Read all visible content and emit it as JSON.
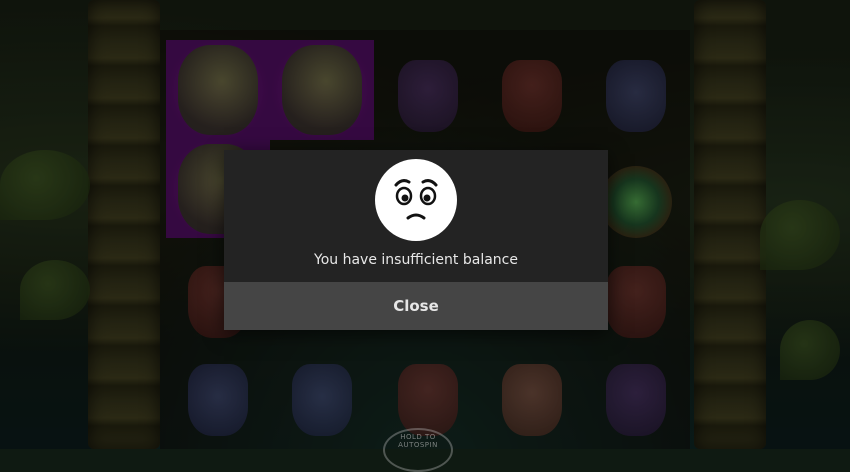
{
  "game": {
    "reels": [
      [
        "turtle",
        "turtle",
        "mask-purple",
        "mask-red",
        "mask-blue"
      ],
      [
        "turtle",
        "turtle",
        "empty",
        "empty",
        "eye"
      ],
      [
        "mask-red",
        "empty",
        "empty",
        "empty",
        "mask-red"
      ],
      [
        "mask-blue",
        "mask-blue",
        "mask-red",
        "mask-horn",
        "mask-purple"
      ]
    ],
    "highlight_color": "#8a1c96",
    "autospin_label": "HOLD TO AUTOSPIN"
  },
  "dialog": {
    "icon": "sad-face-icon",
    "message": "You have insufficient balance",
    "close_label": "Close"
  }
}
